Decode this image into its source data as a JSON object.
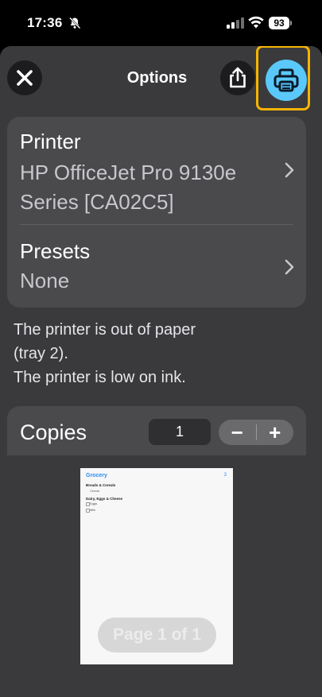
{
  "status_bar": {
    "time": "17:36",
    "battery": "93"
  },
  "header": {
    "title": "Options"
  },
  "printer_row": {
    "label": "Printer",
    "value": "HP OfficeJet Pro 9130e Series [CA02C5]"
  },
  "presets_row": {
    "label": "Presets",
    "value": "None"
  },
  "printer_status": {
    "line1": "The printer is out of paper",
    "line2": "(tray 2).",
    "line3": "The printer is low on ink."
  },
  "copies": {
    "label": "Copies",
    "value": "1",
    "minus": "−",
    "plus": "+"
  },
  "preview": {
    "page_indicator": "Page 1 of 1",
    "doc": {
      "title": "Grocery",
      "count": "3",
      "sections": [
        {
          "name": "Breads & Cereals",
          "items": [
            "Cereal"
          ]
        },
        {
          "name": "Dairy, Eggs & Cheese",
          "items": [
            "Eggs",
            "Milk"
          ]
        }
      ]
    }
  },
  "colors": {
    "accent": "#5ac8fa",
    "highlight": "#f5b400",
    "sheet": "#3a3a3c",
    "card": "#4a4a4d"
  }
}
